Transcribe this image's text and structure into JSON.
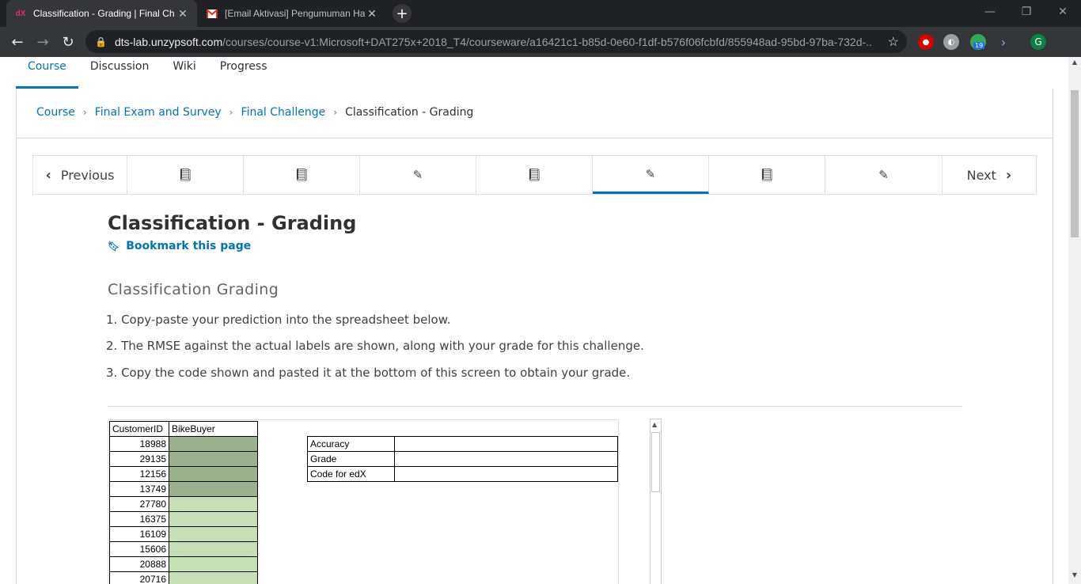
{
  "browser": {
    "tabs": [
      {
        "title": "Classification - Grading | Final Ch",
        "favicon": "edx-icon",
        "active": true
      },
      {
        "title": "[Email Aktivasi] Pengumuman Ha",
        "favicon": "gmail-icon",
        "active": false
      }
    ],
    "url_host": "dts-lab.unzypsoft.com",
    "url_path": "/courses/course-v1:Microsoft+DAT275x+2018_T4/courseware/a16421c1-b85d-0e60-f1df-b576f06fcbfd/855948ad-95bd-97ba-732d-...",
    "extension_badge": "19",
    "profile_initial": "G",
    "favicon_text": "dX"
  },
  "course_nav": {
    "items": [
      "Course",
      "Discussion",
      "Wiki",
      "Progress"
    ]
  },
  "breadcrumb": {
    "course": "Course",
    "section": "Final Exam and Survey",
    "subsection": "Final Challenge",
    "current": "Classification - Grading"
  },
  "sequence": {
    "previous": "Previous",
    "next": "Next"
  },
  "unit": {
    "title": "Classification - Grading",
    "bookmark": "Bookmark this page",
    "subtitle": "Classification Grading",
    "instructions": [
      "1. Copy-paste your prediction into the spreadsheet below.",
      "2. The RMSE against the actual labels are shown, along with your grade for this challenge.",
      "3. Copy the code shown and pasted it at the bottom of this screen to obtain your grade."
    ]
  },
  "sheet": {
    "col_customer": "CustomerID",
    "col_buyer": "BikeBuyer",
    "customer_ids": [
      "18988",
      "29135",
      "12156",
      "13749",
      "27780",
      "16375",
      "16109",
      "15606",
      "20888",
      "20716"
    ],
    "result_labels": [
      "Accuracy",
      "Grade",
      "Code for edX"
    ]
  },
  "colors": {
    "accent": "#0075b4",
    "cell_green": "#c6e0b4",
    "cell_selected": "#9bb08c"
  }
}
